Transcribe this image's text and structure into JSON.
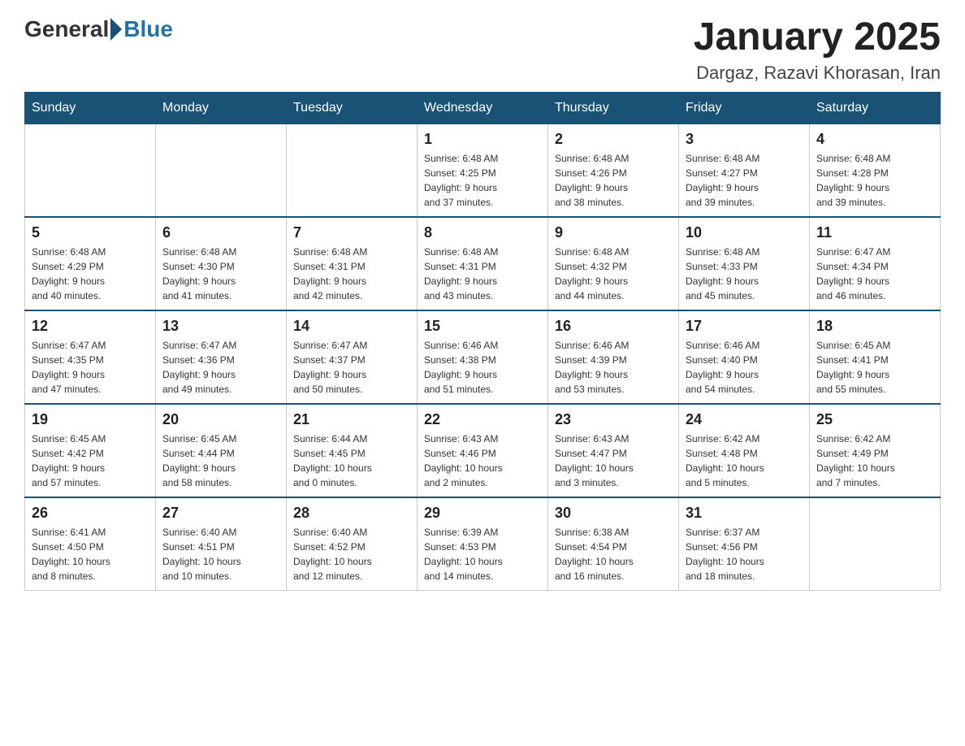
{
  "header": {
    "logo_general": "General",
    "logo_blue": "Blue",
    "month_title": "January 2025",
    "location": "Dargaz, Razavi Khorasan, Iran"
  },
  "weekdays": [
    "Sunday",
    "Monday",
    "Tuesday",
    "Wednesday",
    "Thursday",
    "Friday",
    "Saturday"
  ],
  "weeks": [
    [
      {
        "day": "",
        "info": ""
      },
      {
        "day": "",
        "info": ""
      },
      {
        "day": "",
        "info": ""
      },
      {
        "day": "1",
        "info": "Sunrise: 6:48 AM\nSunset: 4:25 PM\nDaylight: 9 hours\nand 37 minutes."
      },
      {
        "day": "2",
        "info": "Sunrise: 6:48 AM\nSunset: 4:26 PM\nDaylight: 9 hours\nand 38 minutes."
      },
      {
        "day": "3",
        "info": "Sunrise: 6:48 AM\nSunset: 4:27 PM\nDaylight: 9 hours\nand 39 minutes."
      },
      {
        "day": "4",
        "info": "Sunrise: 6:48 AM\nSunset: 4:28 PM\nDaylight: 9 hours\nand 39 minutes."
      }
    ],
    [
      {
        "day": "5",
        "info": "Sunrise: 6:48 AM\nSunset: 4:29 PM\nDaylight: 9 hours\nand 40 minutes."
      },
      {
        "day": "6",
        "info": "Sunrise: 6:48 AM\nSunset: 4:30 PM\nDaylight: 9 hours\nand 41 minutes."
      },
      {
        "day": "7",
        "info": "Sunrise: 6:48 AM\nSunset: 4:31 PM\nDaylight: 9 hours\nand 42 minutes."
      },
      {
        "day": "8",
        "info": "Sunrise: 6:48 AM\nSunset: 4:31 PM\nDaylight: 9 hours\nand 43 minutes."
      },
      {
        "day": "9",
        "info": "Sunrise: 6:48 AM\nSunset: 4:32 PM\nDaylight: 9 hours\nand 44 minutes."
      },
      {
        "day": "10",
        "info": "Sunrise: 6:48 AM\nSunset: 4:33 PM\nDaylight: 9 hours\nand 45 minutes."
      },
      {
        "day": "11",
        "info": "Sunrise: 6:47 AM\nSunset: 4:34 PM\nDaylight: 9 hours\nand 46 minutes."
      }
    ],
    [
      {
        "day": "12",
        "info": "Sunrise: 6:47 AM\nSunset: 4:35 PM\nDaylight: 9 hours\nand 47 minutes."
      },
      {
        "day": "13",
        "info": "Sunrise: 6:47 AM\nSunset: 4:36 PM\nDaylight: 9 hours\nand 49 minutes."
      },
      {
        "day": "14",
        "info": "Sunrise: 6:47 AM\nSunset: 4:37 PM\nDaylight: 9 hours\nand 50 minutes."
      },
      {
        "day": "15",
        "info": "Sunrise: 6:46 AM\nSunset: 4:38 PM\nDaylight: 9 hours\nand 51 minutes."
      },
      {
        "day": "16",
        "info": "Sunrise: 6:46 AM\nSunset: 4:39 PM\nDaylight: 9 hours\nand 53 minutes."
      },
      {
        "day": "17",
        "info": "Sunrise: 6:46 AM\nSunset: 4:40 PM\nDaylight: 9 hours\nand 54 minutes."
      },
      {
        "day": "18",
        "info": "Sunrise: 6:45 AM\nSunset: 4:41 PM\nDaylight: 9 hours\nand 55 minutes."
      }
    ],
    [
      {
        "day": "19",
        "info": "Sunrise: 6:45 AM\nSunset: 4:42 PM\nDaylight: 9 hours\nand 57 minutes."
      },
      {
        "day": "20",
        "info": "Sunrise: 6:45 AM\nSunset: 4:44 PM\nDaylight: 9 hours\nand 58 minutes."
      },
      {
        "day": "21",
        "info": "Sunrise: 6:44 AM\nSunset: 4:45 PM\nDaylight: 10 hours\nand 0 minutes."
      },
      {
        "day": "22",
        "info": "Sunrise: 6:43 AM\nSunset: 4:46 PM\nDaylight: 10 hours\nand 2 minutes."
      },
      {
        "day": "23",
        "info": "Sunrise: 6:43 AM\nSunset: 4:47 PM\nDaylight: 10 hours\nand 3 minutes."
      },
      {
        "day": "24",
        "info": "Sunrise: 6:42 AM\nSunset: 4:48 PM\nDaylight: 10 hours\nand 5 minutes."
      },
      {
        "day": "25",
        "info": "Sunrise: 6:42 AM\nSunset: 4:49 PM\nDaylight: 10 hours\nand 7 minutes."
      }
    ],
    [
      {
        "day": "26",
        "info": "Sunrise: 6:41 AM\nSunset: 4:50 PM\nDaylight: 10 hours\nand 8 minutes."
      },
      {
        "day": "27",
        "info": "Sunrise: 6:40 AM\nSunset: 4:51 PM\nDaylight: 10 hours\nand 10 minutes."
      },
      {
        "day": "28",
        "info": "Sunrise: 6:40 AM\nSunset: 4:52 PM\nDaylight: 10 hours\nand 12 minutes."
      },
      {
        "day": "29",
        "info": "Sunrise: 6:39 AM\nSunset: 4:53 PM\nDaylight: 10 hours\nand 14 minutes."
      },
      {
        "day": "30",
        "info": "Sunrise: 6:38 AM\nSunset: 4:54 PM\nDaylight: 10 hours\nand 16 minutes."
      },
      {
        "day": "31",
        "info": "Sunrise: 6:37 AM\nSunset: 4:56 PM\nDaylight: 10 hours\nand 18 minutes."
      },
      {
        "day": "",
        "info": ""
      }
    ]
  ]
}
